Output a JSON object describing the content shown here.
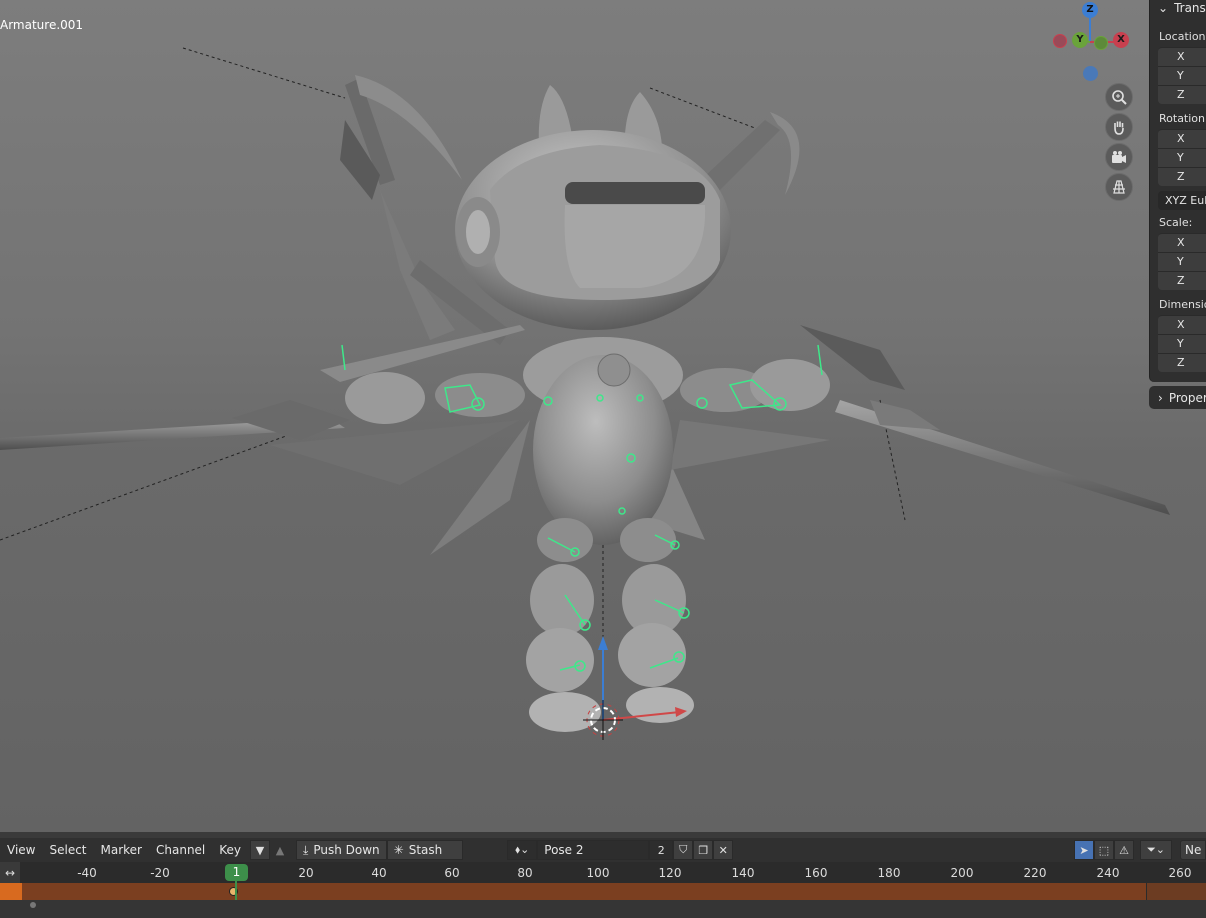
{
  "viewport": {
    "object_name": "Armature.001",
    "gizmo": {
      "z": "Z",
      "y": "Y",
      "x": "X"
    },
    "colors": {
      "x_axis": "#c8404f",
      "y_axis": "#6aa33a",
      "z_axis": "#3c7ed3",
      "bone": "#3ee88a"
    }
  },
  "npanel": {
    "header": "Transf",
    "location": {
      "label": "Location:",
      "x": "X",
      "y": "Y",
      "z": "Z"
    },
    "rotation": {
      "label": "Rotation:",
      "x": "X",
      "y": "Y",
      "z": "Z"
    },
    "rotation_mode": "XYZ Eule",
    "scale": {
      "label": "Scale:",
      "x": "X",
      "y": "Y",
      "z": "Z"
    },
    "dimensions": {
      "label": "Dimensio",
      "x": "X",
      "y": "Y",
      "z": "Z"
    },
    "properties_tab": "Proper"
  },
  "header": {
    "menus": [
      "View",
      "Select",
      "Marker",
      "Channel",
      "Key"
    ],
    "push_down": "Push Down",
    "stash": "Stash",
    "action_name": "Pose 2",
    "action_users": "2",
    "new_label": "Ne"
  },
  "timeline": {
    "ticks": [
      "-40",
      "-20",
      "20",
      "40",
      "60",
      "80",
      "100",
      "120",
      "140",
      "160",
      "180",
      "200",
      "220",
      "240",
      "260"
    ],
    "current_frame": "1"
  }
}
